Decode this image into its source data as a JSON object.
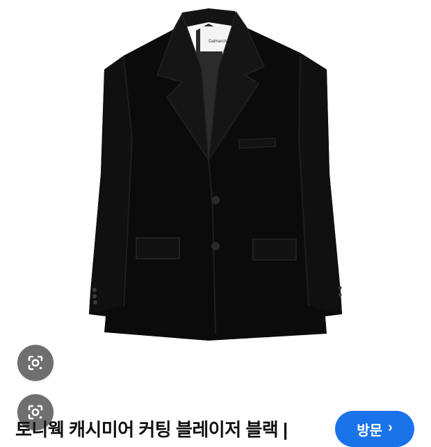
{
  "product": {
    "image_name": "black cashmere blazer",
    "label_text": "Dalmarch",
    "title": "토니웩 캐시미어 커팅 블레이저 블랙 |"
  },
  "actions": {
    "visit_label": "방문",
    "visit_chevron": "›"
  },
  "icons": {
    "lens": "google-lens-icon",
    "visit_arrow": "chevron-right-icon"
  },
  "colors": {
    "accent": "#1a73e8",
    "lens_button": "#6f6f6f",
    "jacket": "#0b0b0b"
  }
}
